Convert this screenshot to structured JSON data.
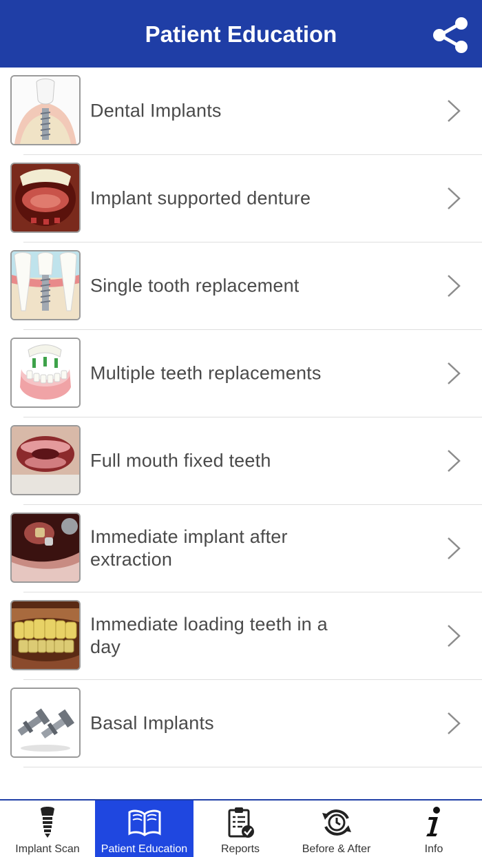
{
  "header": {
    "title": "Patient Education",
    "share_icon": "share-icon"
  },
  "colors": {
    "navbar": "#1f3ea6",
    "active_tab": "#1f47e0",
    "text": "#4a4a4a"
  },
  "topics": [
    {
      "label": "Dental Implants",
      "icon": "dental-implant-diagram-thumbnail"
    },
    {
      "label": "Implant supported denture",
      "icon": "open-mouth-photo-thumbnail"
    },
    {
      "label": "Single tooth replacement",
      "icon": "single-tooth-diagram-thumbnail"
    },
    {
      "label": "Multiple teeth replacements",
      "icon": "multiple-teeth-model-thumbnail"
    },
    {
      "label": "Full mouth fixed teeth",
      "icon": "toothless-mouth-photo-thumbnail"
    },
    {
      "label": "Immediate implant after extraction",
      "icon": "extraction-site-photo-thumbnail"
    },
    {
      "label": "Immediate loading teeth in a day",
      "icon": "teeth-smile-photo-thumbnail"
    },
    {
      "label": "Basal Implants",
      "icon": "basal-implant-screws-thumbnail"
    }
  ],
  "tabs": [
    {
      "label": "Implant Scan",
      "icon": "implant-icon",
      "active": false
    },
    {
      "label": "Patient Education",
      "icon": "open-book-icon",
      "active": true
    },
    {
      "label": "Reports",
      "icon": "clipboard-check-icon",
      "active": false
    },
    {
      "label": "Before & After",
      "icon": "clock-refresh-icon",
      "active": false
    },
    {
      "label": "Info",
      "icon": "info-icon",
      "active": false
    }
  ]
}
